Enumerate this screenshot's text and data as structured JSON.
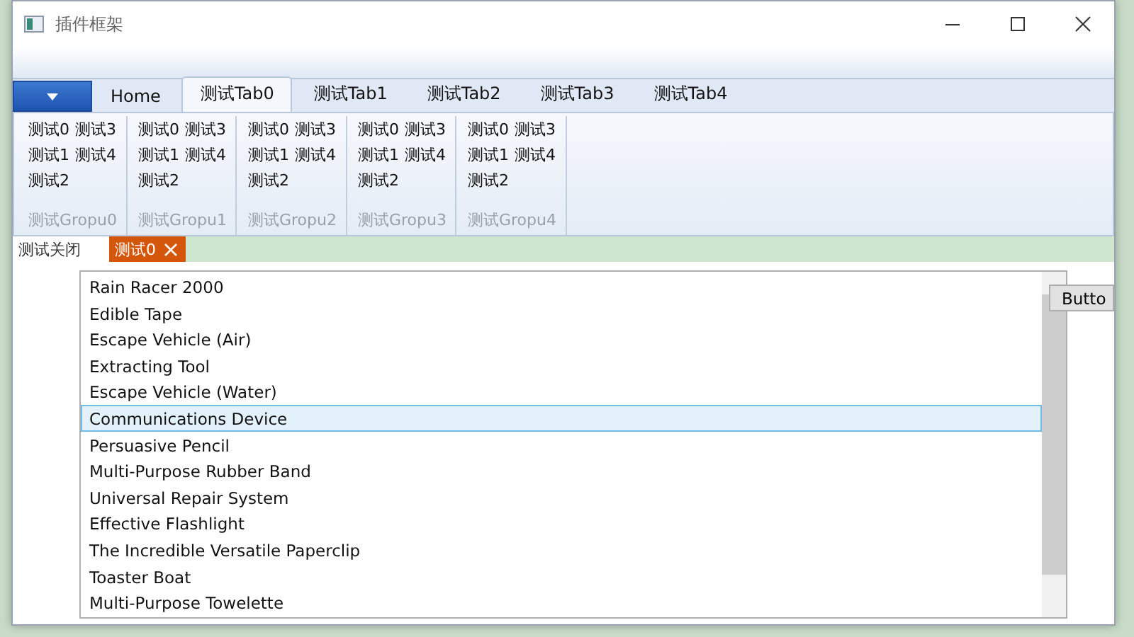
{
  "window": {
    "title": "插件框架"
  },
  "ribbon": {
    "tabs": [
      {
        "label": "Home",
        "selected": false
      },
      {
        "label": "测试Tab0",
        "selected": true
      },
      {
        "label": "测试Tab1",
        "selected": false
      },
      {
        "label": "测试Tab2",
        "selected": false
      },
      {
        "label": "测试Tab3",
        "selected": false
      },
      {
        "label": "测试Tab4",
        "selected": false
      }
    ],
    "groups": [
      {
        "label": "测试Gropu0",
        "items": [
          "测试0",
          "测试1",
          "测试2",
          "测试3",
          "测试4"
        ]
      },
      {
        "label": "测试Gropu1",
        "items": [
          "测试0",
          "测试1",
          "测试2",
          "测试3",
          "测试4"
        ]
      },
      {
        "label": "测试Gropu2",
        "items": [
          "测试0",
          "测试1",
          "测试2",
          "测试3",
          "测试4"
        ]
      },
      {
        "label": "测试Gropu3",
        "items": [
          "测试0",
          "测试1",
          "测试2",
          "测试3",
          "测试4"
        ]
      },
      {
        "label": "测试Gropu4",
        "items": [
          "测试0",
          "测试1",
          "测试2",
          "测试3",
          "测试4"
        ]
      }
    ]
  },
  "doc_tabs": [
    {
      "label": "测试关闭",
      "selected": false,
      "closable": false
    },
    {
      "label": "测试0",
      "selected": true,
      "closable": true
    }
  ],
  "list": [
    {
      "label": "Rain Racer 2000",
      "selected": false
    },
    {
      "label": "Edible Tape",
      "selected": false
    },
    {
      "label": "Escape Vehicle (Air)",
      "selected": false
    },
    {
      "label": "Extracting Tool",
      "selected": false
    },
    {
      "label": "Escape Vehicle (Water)",
      "selected": false
    },
    {
      "label": "Communications Device",
      "selected": true
    },
    {
      "label": "Persuasive Pencil",
      "selected": false
    },
    {
      "label": "Multi-Purpose Rubber Band",
      "selected": false
    },
    {
      "label": "Universal Repair System",
      "selected": false
    },
    {
      "label": "Effective Flashlight",
      "selected": false
    },
    {
      "label": "The Incredible Versatile Paperclip",
      "selected": false
    },
    {
      "label": "Toaster Boat",
      "selected": false
    },
    {
      "label": "Multi-Purpose Towelette",
      "selected": false
    }
  ],
  "button": "Butto"
}
